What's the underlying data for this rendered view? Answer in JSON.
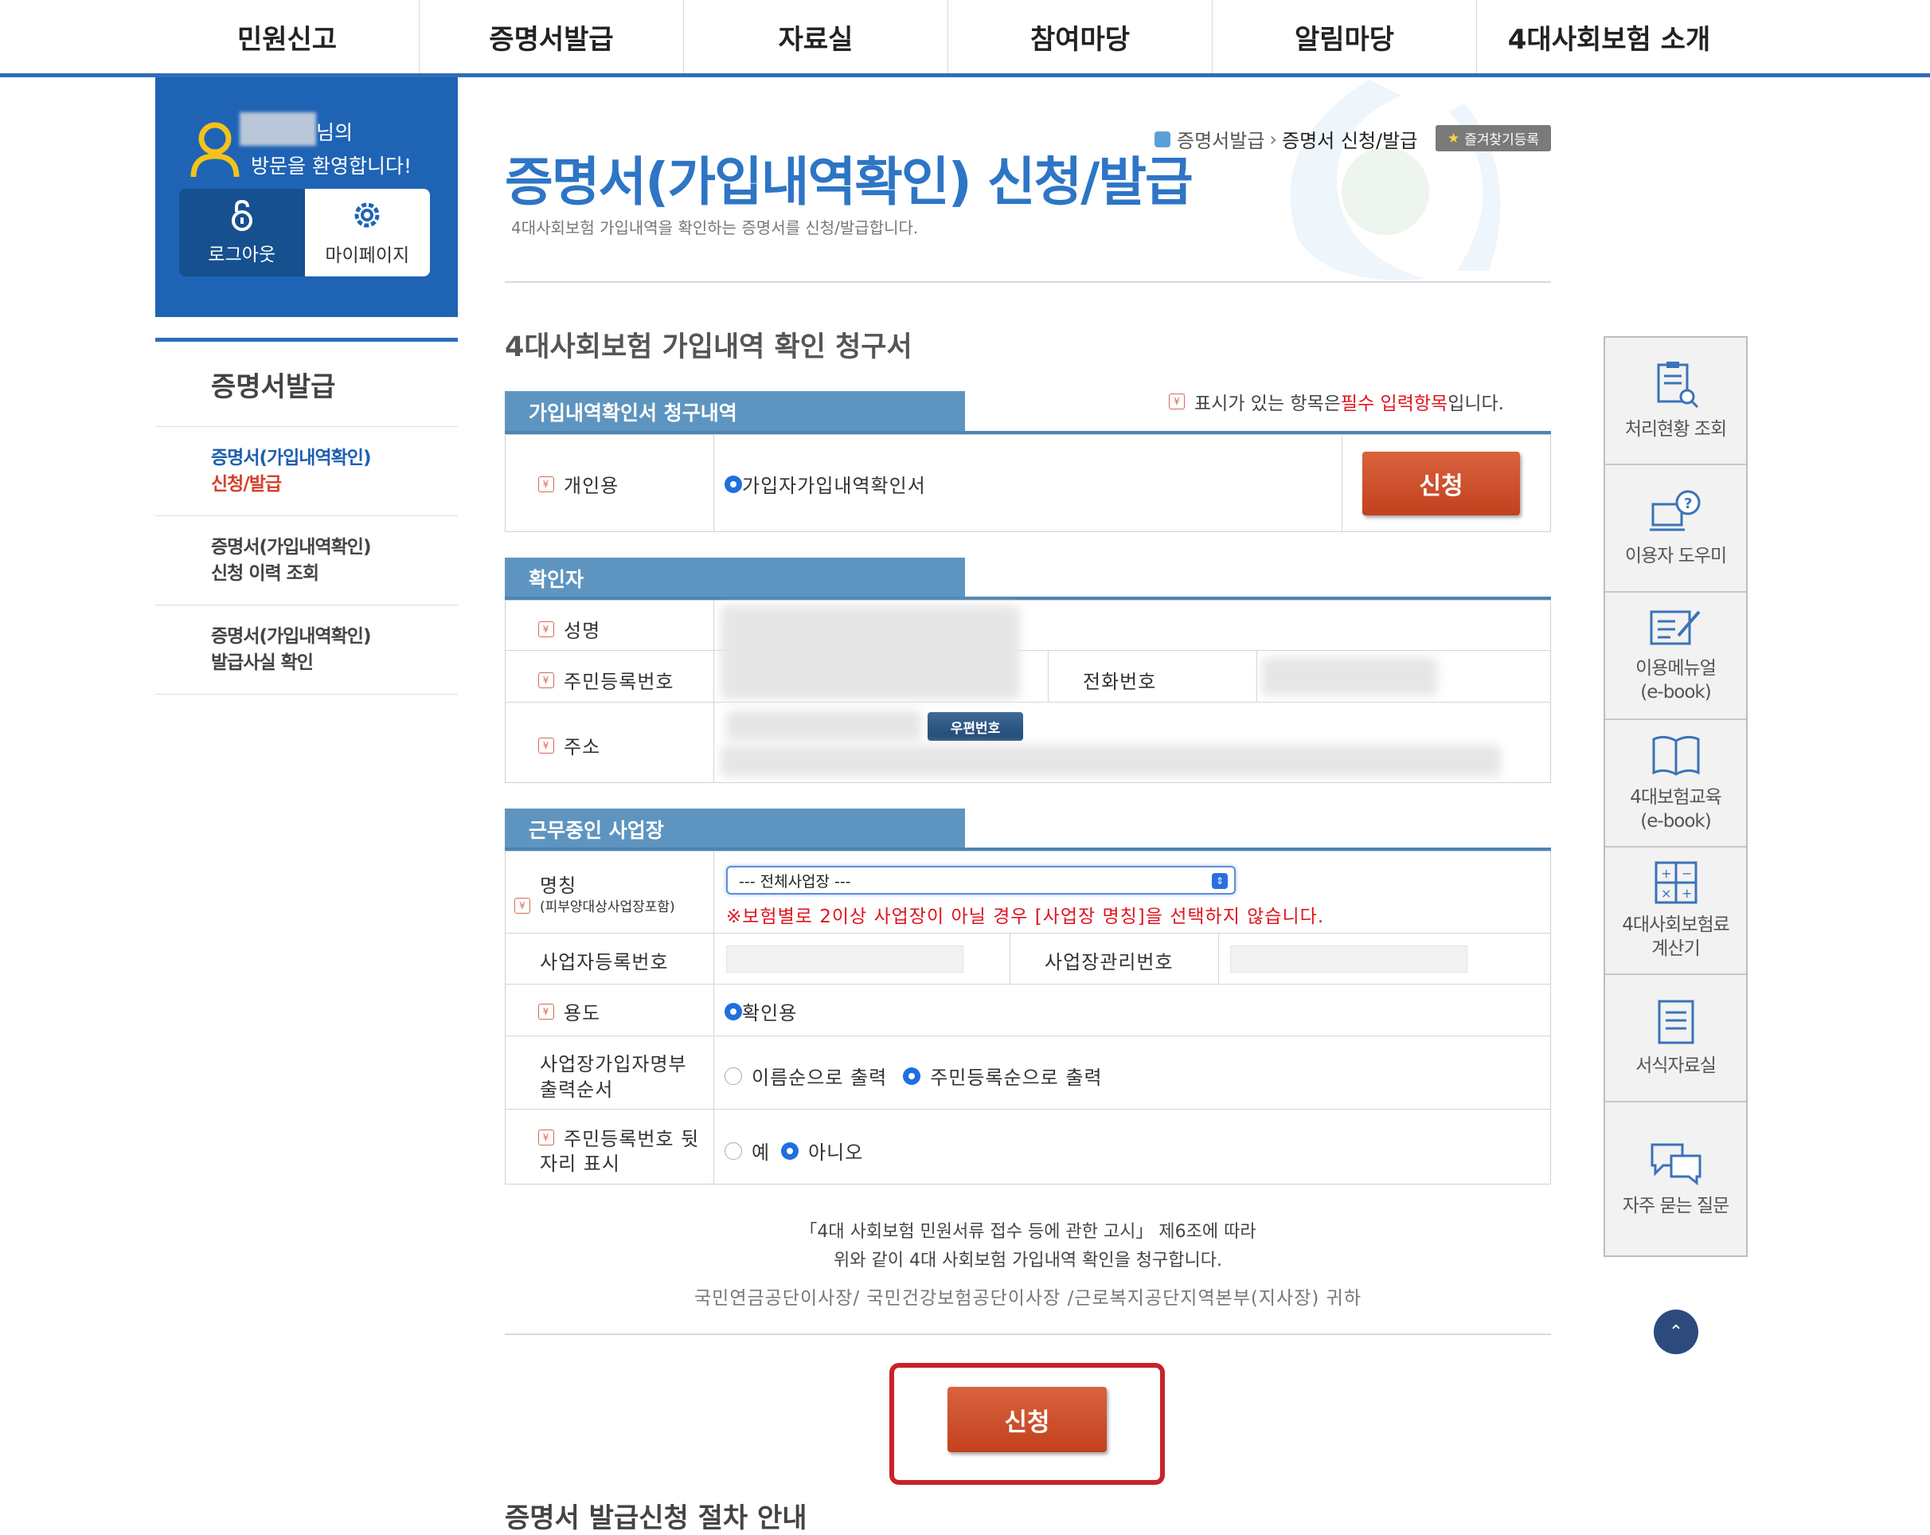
{
  "topnav": {
    "items": [
      "민원신고",
      "증명서발급",
      "자료실",
      "참여마당",
      "알림마당",
      "4대사회보험 소개"
    ]
  },
  "user": {
    "greeting_suffix": "님의",
    "greeting_line2": "방문을 환영합니다!",
    "logout_label": "로그아웃",
    "mypage_label": "마이페이지"
  },
  "lnb": {
    "title": "증명서발급",
    "items": [
      {
        "line1": "증명서(가입내역확인)",
        "line2": "신청/발급",
        "active": true
      },
      {
        "line1": "증명서(가입내역확인)",
        "line2": "신청 이력 조회",
        "active": false
      },
      {
        "line1": "증명서(가입내역확인)",
        "line2": "발급사실 확인",
        "active": false
      }
    ]
  },
  "header": {
    "title": "증명서(가입내역확인) 신청/발급",
    "subtitle": "4대사회보험 가입내역을 확인하는 증명서를 신청/발급합니다.",
    "breadcrumb": [
      "증명서발급",
      "증명서 신청/발급"
    ],
    "favorite_label": "즐겨찾기등록"
  },
  "form": {
    "title": "4대사회보험 가입내역 확인 청구서",
    "required_note": {
      "prefix": "표시가 있는 항목은 ",
      "highlight": "필수 입력항목",
      "suffix": "입니다."
    }
  },
  "section1": {
    "tab": "가입내역확인서 청구내역",
    "personal_label": "개인용",
    "option_label": "가입자가입내역확인서",
    "apply_label": "신청"
  },
  "section2": {
    "tab": "확인자",
    "name_label": "성명",
    "rrn_label": "주민등록번호",
    "phone_label": "전화번호",
    "address_label": "주소",
    "zip_button": "우편번호"
  },
  "section3": {
    "tab": "근무중인 사업장",
    "name_label": "명칭",
    "name_sub": "(피부양대상사업장포함)",
    "select_value": "--- 전체사업장 ---",
    "warning": "※보험별로 2이상 사업장이 아닐 경우 [사업장 명칭]을 선택하지 않습니다.",
    "bizno_label": "사업자등록번호",
    "mgmtno_label": "사업장관리번호",
    "purpose_label": "용도",
    "purpose_value": "확인용",
    "order_label_1": "사업장가입자명부",
    "order_label_2": "출력순서",
    "order_opt1": "이름순으로 출력",
    "order_opt2": "주민등록순으로 출력",
    "rrn_show_label_1": "주민등록번호 뒷",
    "rrn_show_label_2": "자리 표시",
    "yes": "예",
    "no": "아니오"
  },
  "notice": {
    "line1": "「4대 사회보험 민원서류 접수 등에 관한 고시」 제6조에 따라",
    "line2": "위와 같이 4대 사회보험 가입내역 확인을 청구합니다.",
    "line3": "국민연금공단이사장/ 국민건강보험공단이사장 /근로복지공단지역본부(지사장) 귀하"
  },
  "submit_label": "신청",
  "bottom_heading": "증명서 발급신청 절차 안내",
  "quick_menu": [
    {
      "label1": "처리현황 조회",
      "label2": "",
      "icon": "clipboard-search-icon"
    },
    {
      "label1": "이용자 도우미",
      "label2": "",
      "icon": "computer-help-icon"
    },
    {
      "label1": "이용메뉴얼",
      "label2": "(e-book)",
      "icon": "manual-edit-icon"
    },
    {
      "label1": "4대보험교육",
      "label2": "(e-book)",
      "icon": "book-icon"
    },
    {
      "label1": "4대사회보험료",
      "label2": "계산기",
      "icon": "calculator-icon"
    },
    {
      "label1": "서식자료실",
      "label2": "",
      "icon": "document-list-icon"
    },
    {
      "label1": "자주 묻는 질문",
      "label2": "",
      "icon": "chat-bubbles-icon"
    }
  ],
  "colors": {
    "primary_blue": "#2f6db7",
    "title_blue": "#2e75c5",
    "section_tab": "#5e95c0",
    "apply_red": "#c94a26",
    "warning_red": "#e0141f",
    "highlight_border": "#c8222a"
  }
}
